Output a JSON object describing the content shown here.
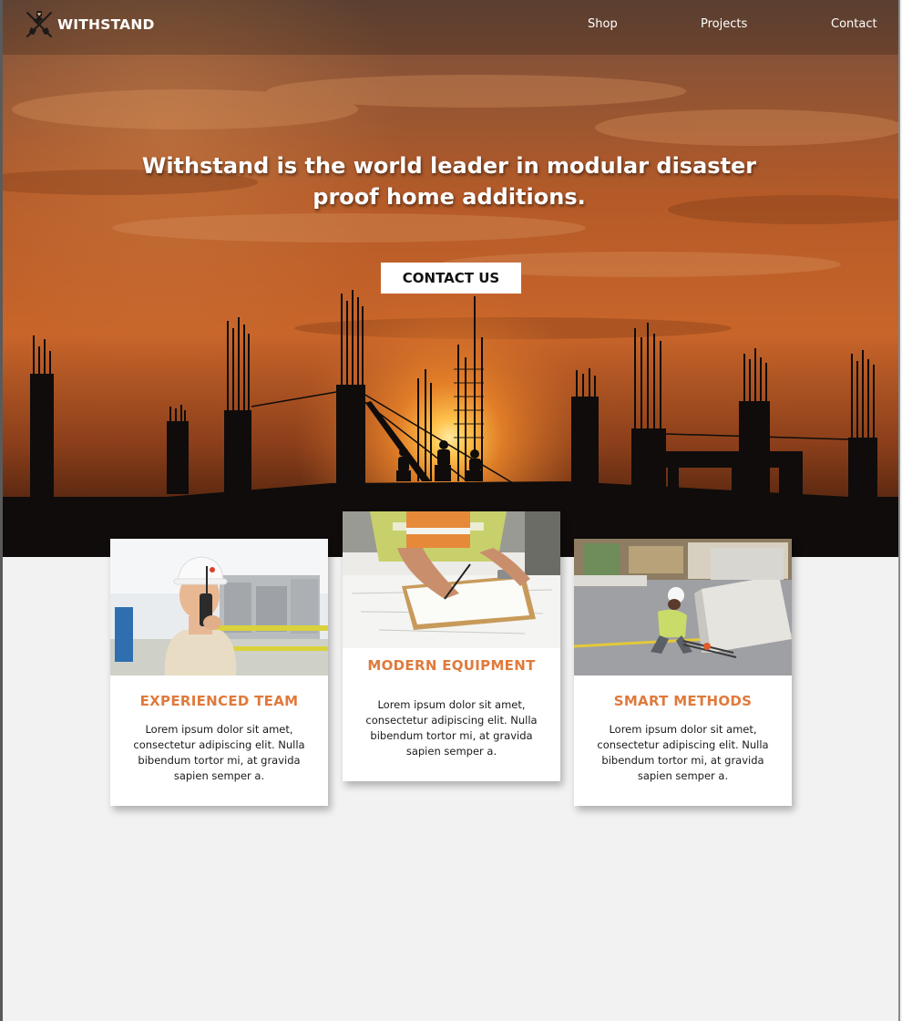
{
  "brand": {
    "name": "WITHSTAND",
    "logo_icon": "shovel-hammer-logo-icon"
  },
  "nav": {
    "items": [
      {
        "label": "Shop"
      },
      {
        "label": "Projects"
      },
      {
        "label": "Contact"
      }
    ]
  },
  "hero": {
    "headline": "Withstand is the world leader in modular disaster proof home additions.",
    "cta_label": "CONTACT US",
    "background": "construction-site-sunset-silhouette"
  },
  "features": [
    {
      "title": "EXPERIENCED TEAM",
      "text": "Lorem ipsum dolor sit amet, consectetur adipiscing elit. Nulla bibendum tortor mi, at gravida sapien semper a.",
      "photo": "worker-with-radio-photo"
    },
    {
      "title": "MODERN EQUIPMENT",
      "text": "Lorem ipsum dolor sit amet, consectetur adipiscing elit. Nulla bibendum tortor mi, at gravida sapien semper a.",
      "photo": "worker-writing-clipboard-photo"
    },
    {
      "title": "SMART METHODS",
      "text": "Lorem ipsum dolor sit amet, consectetur adipiscing elit. Nulla bibendum tortor mi, at gravida sapien semper a.",
      "photo": "worker-street-barriers-photo"
    }
  ],
  "colors": {
    "accent": "#e07a3c",
    "page_background": "#f2f2f2",
    "card_background": "#ffffff",
    "nav_text": "#ffffff"
  }
}
